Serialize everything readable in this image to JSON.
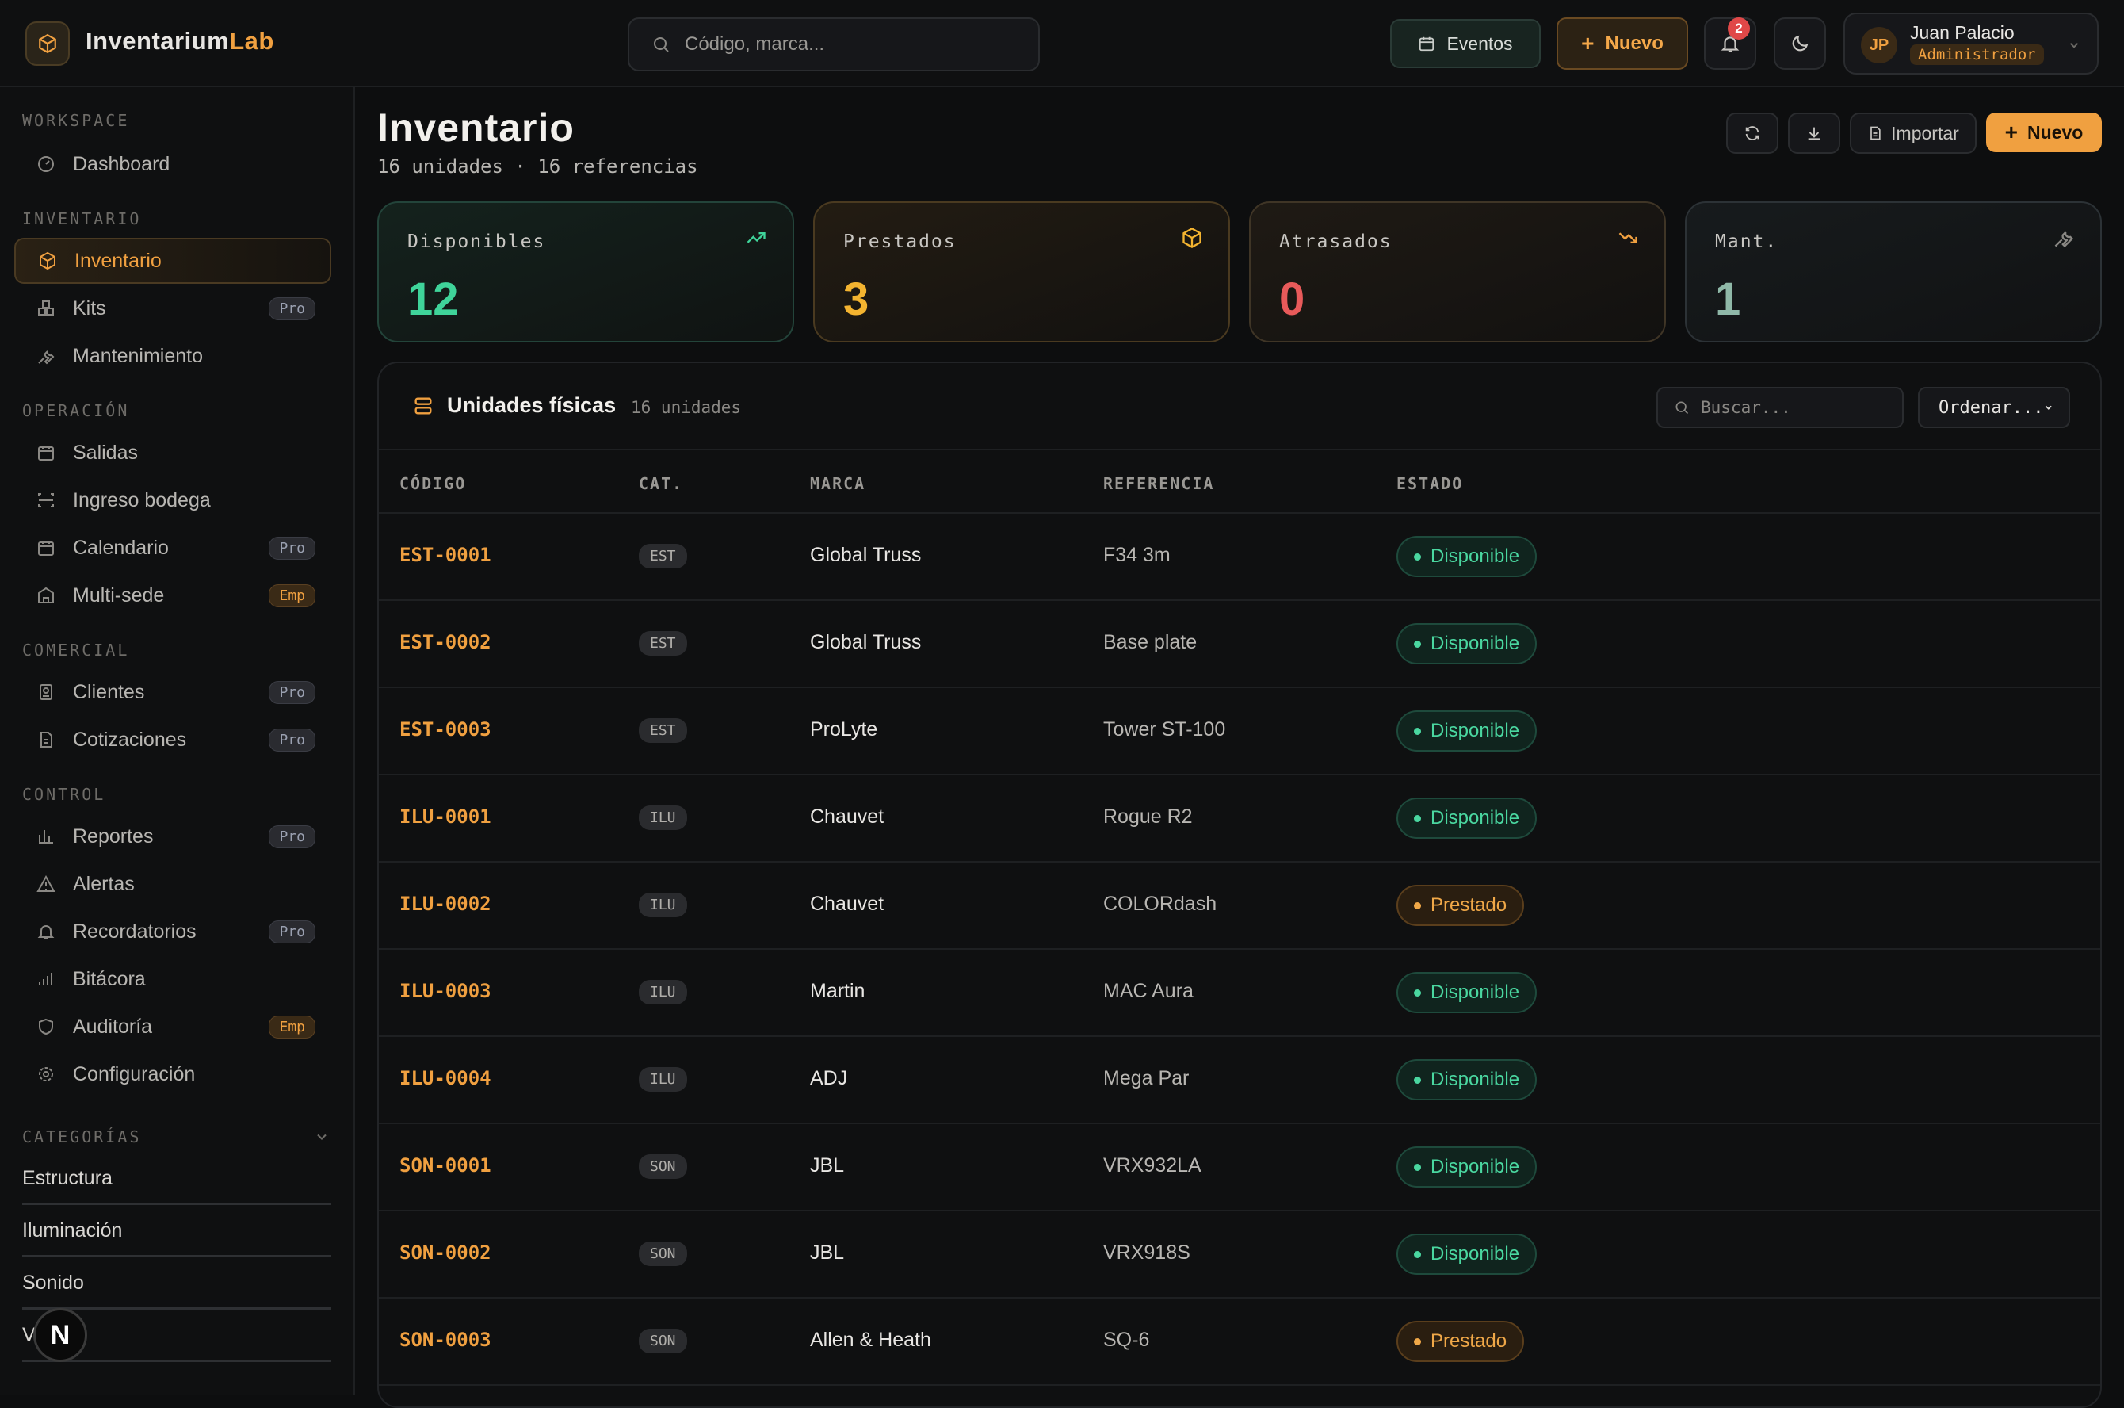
{
  "header": {
    "logo_text_a": "Inventarium",
    "logo_text_b": "Lab",
    "search_placeholder": "Código, marca...",
    "events_label": "Eventos",
    "new_label": "Nuevo",
    "notif_count": "2",
    "user_initials": "JP",
    "user_name": "Juan Palacio",
    "user_role": "Administrador"
  },
  "sidebar": {
    "workspace_label": "WORKSPACE",
    "dashboard": "Dashboard",
    "inventario_label": "INVENTARIO",
    "inventario": "Inventario",
    "kits": "Kits",
    "mantenimiento": "Mantenimiento",
    "operacion_label": "OPERACIÓN",
    "salidas": "Salidas",
    "ingreso": "Ingreso bodega",
    "calendario": "Calendario",
    "multisede": "Multi-sede",
    "comercial_label": "COMERCIAL",
    "clientes": "Clientes",
    "cotizaciones": "Cotizaciones",
    "control_label": "CONTROL",
    "reportes": "Reportes",
    "alertas": "Alertas",
    "recordatorios": "Recordatorios",
    "bitacora": "Bitácora",
    "auditoria": "Auditoría",
    "configuracion": "Configuración",
    "categorias_label": "CATEGORÍAS",
    "badge_pro": "Pro",
    "badge_emp": "Emp",
    "categories": [
      "Estructura",
      "Iluminación",
      "Sonido",
      "V"
    ],
    "bubble_letter": "N"
  },
  "main": {
    "title": "Inventario",
    "subtitle": "16 unidades · 16 referencias",
    "import_label": "Importar",
    "new_label": "Nuevo",
    "stats": [
      {
        "label": "Disponibles",
        "value": "12",
        "color": "#3fd49a"
      },
      {
        "label": "Prestados",
        "value": "3",
        "color": "#f4b430"
      },
      {
        "label": "Atrasados",
        "value": "0",
        "color": "#e85a5a"
      },
      {
        "label": "Mant.",
        "value": "1",
        "color": "#8fb8a8"
      }
    ],
    "panel_title": "Unidades físicas",
    "panel_count": "16 unidades",
    "panel_search_placeholder": "Buscar...",
    "sort_label": "Ordenar...",
    "columns": [
      "CÓDIGO",
      "CAT.",
      "MARCA",
      "REFERENCIA",
      "ESTADO"
    ],
    "rows": [
      {
        "code": "EST-0001",
        "cat": "EST",
        "brand": "Global Truss",
        "ref": "F34 3m",
        "status": "Disponible"
      },
      {
        "code": "EST-0002",
        "cat": "EST",
        "brand": "Global Truss",
        "ref": "Base plate",
        "status": "Disponible"
      },
      {
        "code": "EST-0003",
        "cat": "EST",
        "brand": "ProLyte",
        "ref": "Tower ST-100",
        "status": "Disponible"
      },
      {
        "code": "ILU-0001",
        "cat": "ILU",
        "brand": "Chauvet",
        "ref": "Rogue R2",
        "status": "Disponible"
      },
      {
        "code": "ILU-0002",
        "cat": "ILU",
        "brand": "Chauvet",
        "ref": "COLORdash",
        "status": "Prestado"
      },
      {
        "code": "ILU-0003",
        "cat": "ILU",
        "brand": "Martin",
        "ref": "MAC Aura",
        "status": "Disponible"
      },
      {
        "code": "ILU-0004",
        "cat": "ILU",
        "brand": "ADJ",
        "ref": "Mega Par",
        "status": "Disponible"
      },
      {
        "code": "SON-0001",
        "cat": "SON",
        "brand": "JBL",
        "ref": "VRX932LA",
        "status": "Disponible"
      },
      {
        "code": "SON-0002",
        "cat": "SON",
        "brand": "JBL",
        "ref": "VRX918S",
        "status": "Disponible"
      },
      {
        "code": "SON-0003",
        "cat": "SON",
        "brand": "Allen & Heath",
        "ref": "SQ-6",
        "status": "Prestado"
      }
    ]
  }
}
